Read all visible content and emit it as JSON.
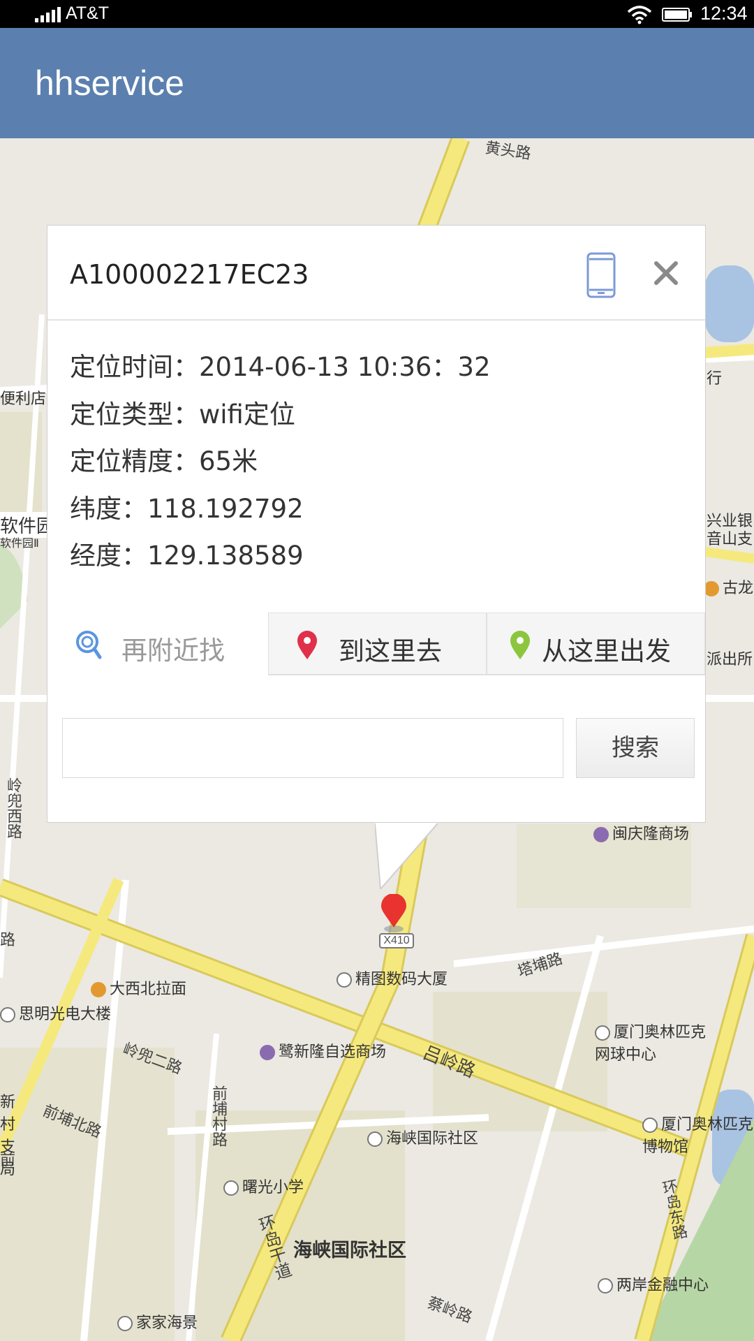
{
  "status_bar": {
    "carrier": "AT&T",
    "time": "12:34"
  },
  "app_bar": {
    "title": "hhservice",
    "color": "#5b80af"
  },
  "popup": {
    "device_id": "A100002217EC23",
    "info": [
      {
        "label": "定位时间：",
        "value": "2014-06-13  10:36：32"
      },
      {
        "label": "定位类型：",
        "value": "wifi定位"
      },
      {
        "label": "定位精度：",
        "value": "65米"
      },
      {
        "label": "纬度：",
        "value": "118.192792"
      },
      {
        "label": "经度：",
        "value": "129.138589"
      }
    ],
    "tabs": [
      {
        "label": "再附近找",
        "icon": "search-nearby-icon"
      },
      {
        "label": "到这里去",
        "icon": "red-pin-icon"
      },
      {
        "label": "从这里出发",
        "icon": "green-pin-icon"
      }
    ],
    "search": {
      "placeholder": "",
      "button_label": "搜索"
    }
  },
  "map": {
    "route_shield": "X410",
    "labels": {
      "huangtou_road": "黄头路",
      "convenience_store": "便利店",
      "software_park": "软件园",
      "software_park_2": "软件园Ⅱ",
      "xingye_bank": "兴业银",
      "yinshan_branch": "音山支",
      "gulong": "古龙",
      "police_station": "派出所",
      "bank_sign": "行",
      "lingdou_west": "岭兜西路",
      "minqinglong_mall": "闽庆隆商场",
      "road_lu": "路",
      "daxibei_noodles": "大西北拉面",
      "jingtu_building": "精图数码大厦",
      "tapu_road": "塔埔路",
      "siming_building": "思明光电大楼",
      "lingdou_2nd_road": "岭兜二路",
      "lulong_mall": "鹭新隆自选商场",
      "lvling_road": "吕岭路",
      "olympic_tennis": "厦门奥林匹克网球中心",
      "xincun_branch": "新村支局",
      "qianpu_north_road": "前埔北路",
      "qianpu_village_road": "前埔村路",
      "haixia_community": "海峡国际社区",
      "olympic_museum": "厦门奥林匹克博物馆",
      "qian_road": "前",
      "shuguang_school": "曙光小学",
      "huandao_east_road": "环岛东路",
      "huandao_main_road": "环岛干道",
      "haixia_community_big": "海峡国际社区",
      "liangan_finance": "两岸金融中心",
      "jiajia_mall": "家家海景",
      "cailing_road": "蔡岭路"
    }
  }
}
